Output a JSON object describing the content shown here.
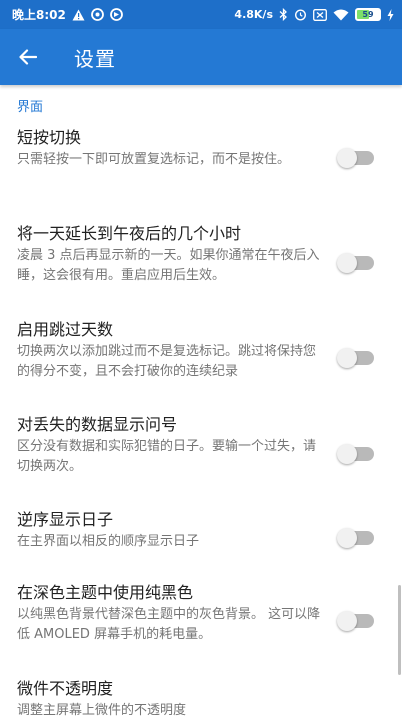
{
  "status_bar": {
    "time": "晚上8:02",
    "network_speed": "4.8K/s",
    "battery_level": "59",
    "battery_percent": 59,
    "icons": [
      "warning-icon",
      "app-icon-1",
      "app-icon-2",
      "bluetooth-icon",
      "alarm-icon",
      "sim-icon",
      "wifi-icon",
      "battery-icon",
      "charging-icon"
    ]
  },
  "app_bar": {
    "title": "设置",
    "back_icon": "arrow-left-icon",
    "color": "#2479d4"
  },
  "section": {
    "header": "界面"
  },
  "preferences": [
    {
      "title": "短按切换",
      "summary": "只需轻按一下即可放置复选标记，而不是按住。",
      "enabled": false
    },
    {
      "title": "将一天延长到午夜后的几个小时",
      "summary": "凌晨 3 点后再显示新的一天。如果你通常在午夜后入睡，这会很有用。重启应用后生效。",
      "enabled": false
    },
    {
      "title": "启用跳过天数",
      "summary": "切换两次以添加跳过而不是复选标记。跳过将保持您的得分不变，且不会打破你的连续纪录",
      "enabled": false
    },
    {
      "title": "对丢失的数据显示问号",
      "summary": "区分没有数据和实际犯错的日子。要输一个过失，请切换两次。",
      "enabled": false
    },
    {
      "title": "逆序显示日子",
      "summary": "在主界面以相反的顺序显示日子",
      "enabled": false
    },
    {
      "title": "在深色主题中使用纯黑色",
      "summary": "以纯黑色背景代替深色主题中的灰色背景。 这可以降低 AMOLED 屏幕手机的耗电量。",
      "enabled": false
    },
    {
      "title": "微件不透明度",
      "summary": "调整主屏幕上微件的不透明度",
      "enabled": null
    }
  ]
}
